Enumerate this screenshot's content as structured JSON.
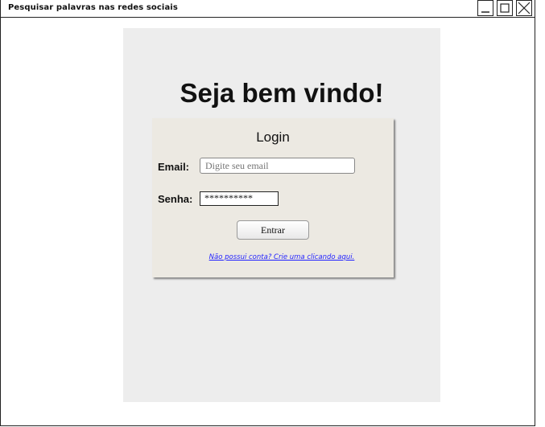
{
  "window": {
    "title": "Pesquisar palavras nas redes sociais"
  },
  "main": {
    "welcome": "Seja bem vindo!",
    "login": {
      "title": "Login",
      "email_label": "Email:",
      "email_placeholder": "Digite seu email",
      "password_label": "Senha:",
      "password_value": "**********",
      "submit_label": "Entrar",
      "signup_link": "Não possui conta? Crie uma clicando aqui."
    }
  },
  "colors": {
    "panel_bg": "#ededed",
    "login_box_bg": "#ece9e2",
    "link": "#1f1fff"
  }
}
